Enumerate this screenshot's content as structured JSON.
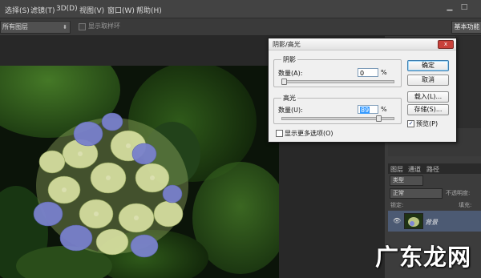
{
  "menu": {
    "items": [
      "选择(S)",
      "滤镜(T)",
      "3D(D)",
      "视图(V)",
      "窗口(W)",
      "帮助(H)"
    ]
  },
  "window_controls": {
    "minimize": "▁",
    "restore": "□"
  },
  "options_bar": {
    "layer_select": "所有图层",
    "sample_checkbox_label": "显示取样环",
    "workspace_button": "基本功能"
  },
  "dialog": {
    "title": "阴影/高光",
    "close": "x",
    "shadows": {
      "group_label": "阴影",
      "amount_label": "数量(A):",
      "amount_value": "0",
      "unit": "%",
      "slider_level": 0.0
    },
    "highlights": {
      "group_label": "高光",
      "amount_label": "数量(U):",
      "amount_value": "89",
      "unit": "%",
      "slider_level": 0.89
    },
    "more_options_label": "显示更多选项(O)",
    "more_options_checked": false,
    "buttons": {
      "ok": "确定",
      "cancel": "取消",
      "load": "载入(L)...",
      "save": "存储(S)..."
    },
    "preview_label": "预览(P)",
    "preview_checked": true,
    "preview_check_mark": "✓"
  },
  "layers_panel": {
    "tabs": [
      "图层",
      "通道",
      "路径"
    ],
    "kind": "类型",
    "blend_mode": "正常",
    "opacity_label": "不透明度:",
    "lock_label": "锁定:",
    "fill_label": "填充:",
    "layer_name": "背景",
    "eye_icon": "eye-icon"
  },
  "watermark": "广东龙网"
}
